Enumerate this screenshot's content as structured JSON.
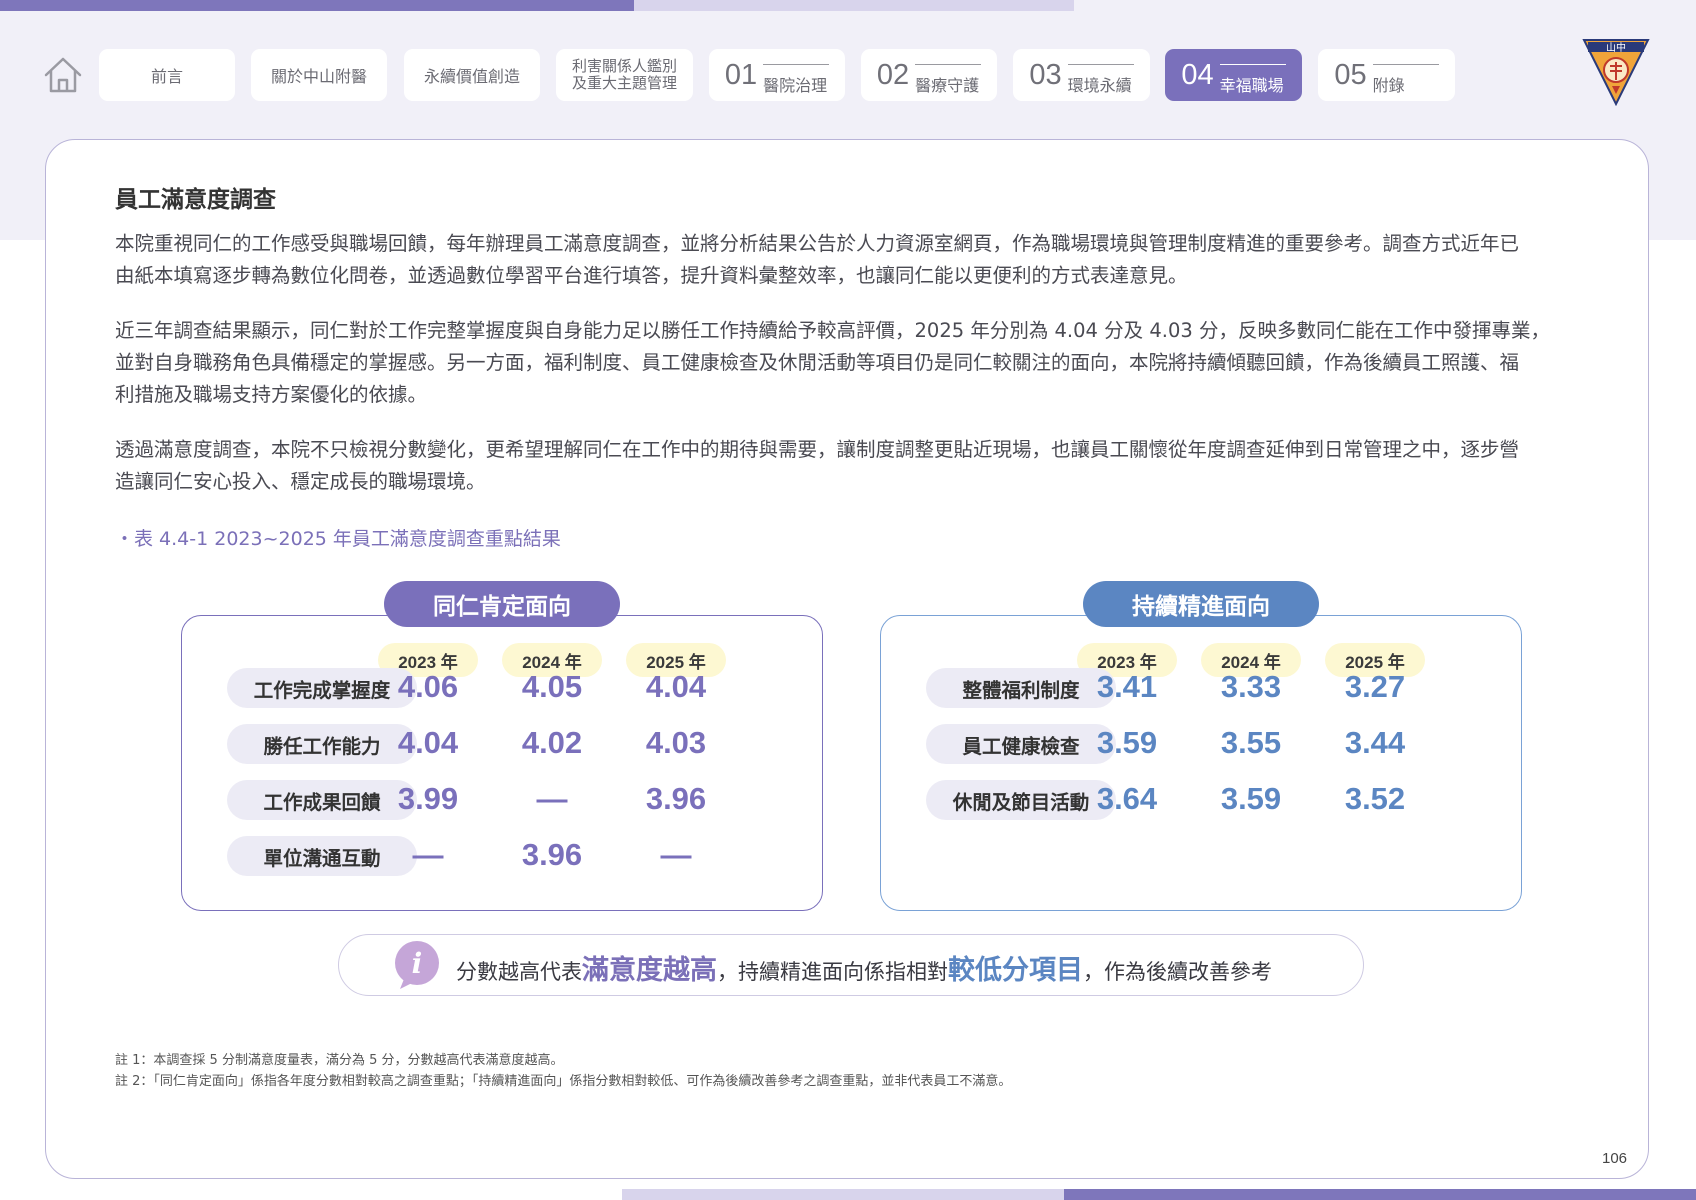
{
  "nav": {
    "tabs": [
      {
        "label": "前言"
      },
      {
        "label": "關於中山附醫"
      },
      {
        "label": "永續價值創造"
      },
      {
        "label_line1": "利害關係人鑑別",
        "label_line2": "及重大主題管理"
      },
      {
        "num": "01",
        "label": "醫院治理"
      },
      {
        "num": "02",
        "label": "醫療守護"
      },
      {
        "num": "03",
        "label": "環境永續"
      },
      {
        "num": "04",
        "label": "幸福職場"
      },
      {
        "num": "05",
        "label": "附錄"
      }
    ],
    "logo_text": "山中"
  },
  "section_title": "員工滿意度調查",
  "paragraphs": [
    {
      "line1": "本院重視同仁的工作感受與職場回饋，每年辦理員工滿意度調查，並將分析結果公告於人力資源室網頁，作為職場環境與管理制度精進的重要參考。調查方式近年已",
      "line2": "由紙本填寫逐步轉為數位化問卷，並透過數位學習平台進行填答，提升資料彙整效率，也讓同仁能以更便利的方式表達意見。"
    },
    {
      "line1": "近三年調查結果顯示，同仁對於工作完整掌握度與自身能力足以勝任工作持續給予較高評價，2025 年分別為 4.04 分及 4.03 分，反映多數同仁能在工作中發揮專業，",
      "line2": "並對自身職務角色具備穩定的掌握感。另一方面，福利制度、員工健康檢查及休閒活動等項目仍是同仁較關注的面向，本院將持續傾聽回饋，作為後續員工照護、福",
      "line3": "利措施及職場支持方案優化的依據。"
    },
    {
      "line1": "透過滿意度調查，本院不只檢視分數變化，更希望理解同仁在工作中的期待與需要，讓制度調整更貼近現場，也讓員工關懷從年度調查延伸到日常管理之中，逐步營",
      "line2": "造讓同仁安心投入、穩定成長的職場環境。"
    }
  ],
  "table_caption": "・表 4.4-1  2023~2025 年員工滿意度調查重點結果",
  "chart_data": {
    "type": "table",
    "panels": [
      {
        "title": "同仁肯定面向",
        "color": "#7a70bb",
        "years": [
          "2023 年",
          "2024 年",
          "2025 年"
        ],
        "rows": [
          {
            "label": "工作完成掌握度",
            "values": [
              "4.06",
              "4.05",
              "4.04"
            ]
          },
          {
            "label": "勝任工作能力",
            "values": [
              "4.04",
              "4.02",
              "4.03"
            ]
          },
          {
            "label": "工作成果回饋",
            "values": [
              "3.99",
              "—",
              "3.96"
            ]
          },
          {
            "label": "單位溝通互動",
            "values": [
              "—",
              "3.96",
              "—"
            ]
          }
        ]
      },
      {
        "title": "持續精進面向",
        "color": "#5b86c2",
        "years": [
          "2023 年",
          "2024 年",
          "2025 年"
        ],
        "rows": [
          {
            "label": "整體福利制度",
            "values": [
              "3.41",
              "3.33",
              "3.27"
            ]
          },
          {
            "label": "員工健康檢查",
            "values": [
              "3.59",
              "3.55",
              "3.44"
            ]
          },
          {
            "label": "休閒及節目活動",
            "values": [
              "3.64",
              "3.59",
              "3.52"
            ]
          }
        ]
      }
    ]
  },
  "note": {
    "part1": "分數越高代表",
    "highlight1": "滿意度越高",
    "part2": "，持續精進面向係指相對",
    "highlight2": "較低分項目",
    "part3": "，作為後續改善參考",
    "icon_letter": "i"
  },
  "footnotes": [
    "註 1：本調查採 5 分制滿意度量表，滿分為 5 分，分數越高代表滿意度越高。",
    "註 2：「同仁肯定面向」係指各年度分數相對較高之調查重點；「持續精進面向」係指分數相對較低、可作為後續改善參考之調查重點，並非代表員工不滿意。"
  ],
  "page_number": "106",
  "colors": {
    "purple": "#7a70bb",
    "blue": "#5b86c2",
    "year_bg": "#fdf8d2",
    "label_bg": "#ecebf5"
  }
}
